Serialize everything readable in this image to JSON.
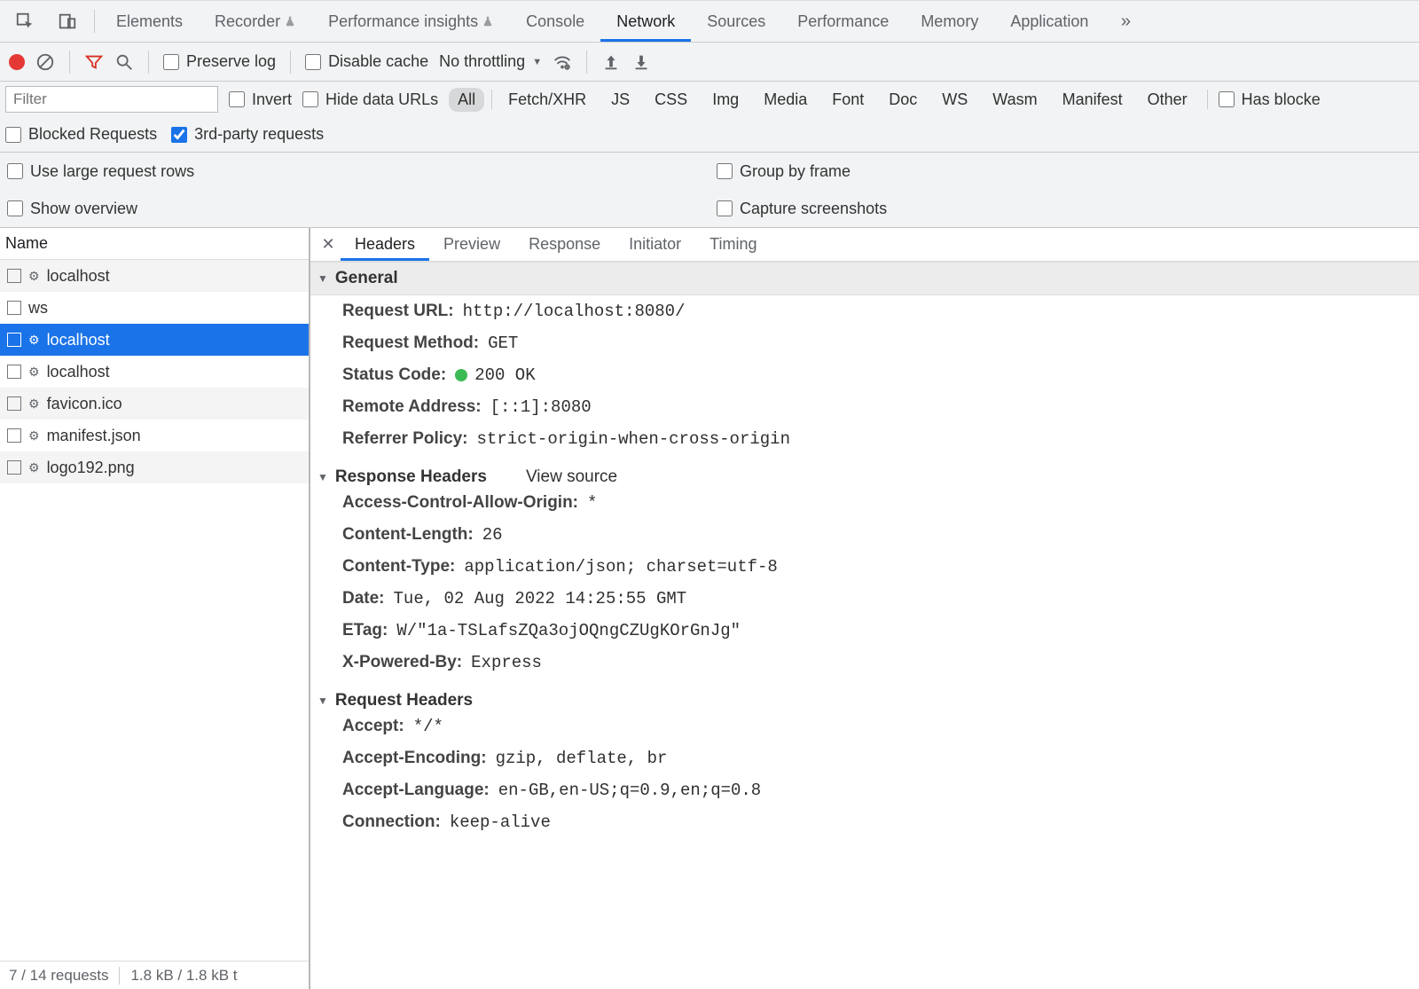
{
  "tabs": [
    "Elements",
    "Recorder",
    "Performance insights",
    "Console",
    "Network",
    "Sources",
    "Performance",
    "Memory",
    "Application"
  ],
  "active_tab": 4,
  "toolbar": {
    "preserve_log": "Preserve log",
    "disable_cache": "Disable cache",
    "throttling": "No throttling"
  },
  "filter": {
    "placeholder": "Filter",
    "invert": "Invert",
    "hide_data_urls": "Hide data URLs",
    "types": [
      "All",
      "Fetch/XHR",
      "JS",
      "CSS",
      "Img",
      "Media",
      "Font",
      "Doc",
      "WS",
      "Wasm",
      "Manifest",
      "Other"
    ],
    "active_type": 0,
    "has_blocked": "Has blocke",
    "blocked_requests": "Blocked Requests",
    "third_party": "3rd-party requests"
  },
  "options": {
    "large_rows": "Use large request rows",
    "group_by_frame": "Group by frame",
    "show_overview": "Show overview",
    "capture_screenshots": "Capture screenshots"
  },
  "requests": {
    "header": "Name",
    "items": [
      {
        "name": "localhost",
        "gear": true
      },
      {
        "name": "ws",
        "gear": false
      },
      {
        "name": "localhost",
        "gear": true,
        "selected": true
      },
      {
        "name": "localhost",
        "gear": true
      },
      {
        "name": "favicon.ico",
        "gear": true
      },
      {
        "name": "manifest.json",
        "gear": true
      },
      {
        "name": "logo192.png",
        "gear": true
      }
    ],
    "footer_requests": "7 / 14 requests",
    "footer_size": "1.8 kB / 1.8 kB t"
  },
  "detail": {
    "tabs": [
      "Headers",
      "Preview",
      "Response",
      "Initiator",
      "Timing"
    ],
    "active": 0,
    "sections": {
      "general": {
        "title": "General",
        "rows": [
          {
            "k": "Request URL:",
            "v": "http://localhost:8080/"
          },
          {
            "k": "Request Method:",
            "v": "GET"
          },
          {
            "k": "Status Code:",
            "v": "200 OK",
            "status": true
          },
          {
            "k": "Remote Address:",
            "v": "[::1]:8080"
          },
          {
            "k": "Referrer Policy:",
            "v": "strict-origin-when-cross-origin"
          }
        ]
      },
      "response": {
        "title": "Response Headers",
        "view_source": "View source",
        "rows": [
          {
            "k": "Access-Control-Allow-Origin:",
            "v": "*"
          },
          {
            "k": "Content-Length:",
            "v": "26"
          },
          {
            "k": "Content-Type:",
            "v": "application/json; charset=utf-8"
          },
          {
            "k": "Date:",
            "v": "Tue, 02 Aug 2022 14:25:55 GMT"
          },
          {
            "k": "ETag:",
            "v": "W/\"1a-TSLafsZQa3ojOQngCZUgKOrGnJg\""
          },
          {
            "k": "X-Powered-By:",
            "v": "Express"
          }
        ]
      },
      "request": {
        "title": "Request Headers",
        "rows": [
          {
            "k": "Accept:",
            "v": "*/*"
          },
          {
            "k": "Accept-Encoding:",
            "v": "gzip, deflate, br"
          },
          {
            "k": "Accept-Language:",
            "v": "en-GB,en-US;q=0.9,en;q=0.8"
          },
          {
            "k": "Connection:",
            "v": "keep-alive"
          }
        ]
      }
    }
  }
}
